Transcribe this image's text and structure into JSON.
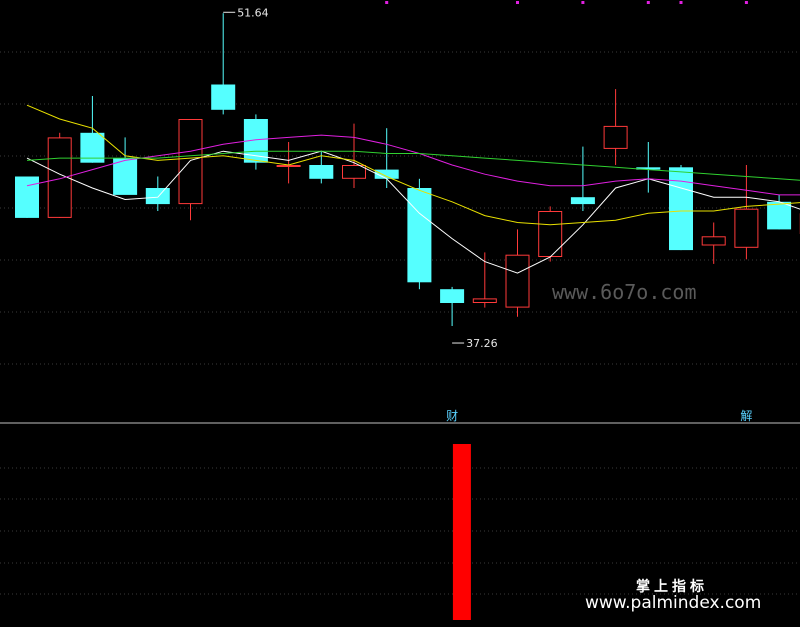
{
  "chart_data": [
    {
      "type": "candlestick",
      "panel": "price",
      "ylim": [
        34,
        52
      ],
      "grid": true,
      "colors": {
        "up": "#ff3a3a",
        "down": "#55ffff",
        "ma_white": "#ffffff",
        "ma_yellow": "#e8e000",
        "ma_magenta": "#e020e0",
        "ma_green": "#30d030"
      },
      "candles": [
        {
          "o": 44.5,
          "h": 44.5,
          "l": 42.7,
          "c": 42.7
        },
        {
          "o": 42.7,
          "h": 46.4,
          "l": 42.7,
          "c": 46.2
        },
        {
          "o": 46.4,
          "h": 48.0,
          "l": 45.1,
          "c": 45.1
        },
        {
          "o": 45.3,
          "h": 46.2,
          "l": 43.8,
          "c": 43.7
        },
        {
          "o": 44.0,
          "h": 44.5,
          "l": 43.0,
          "c": 43.3
        },
        {
          "o": 43.3,
          "h": 47.0,
          "l": 42.6,
          "c": 47.0
        },
        {
          "o": 48.5,
          "h": 51.6,
          "l": 47.2,
          "c": 47.4
        },
        {
          "o": 47.0,
          "h": 47.2,
          "l": 44.8,
          "c": 45.1
        },
        {
          "o": 45.0,
          "h": 46.0,
          "l": 44.2,
          "c": 45.0
        },
        {
          "o": 45.0,
          "h": 45.6,
          "l": 44.2,
          "c": 44.4
        },
        {
          "o": 44.4,
          "h": 46.8,
          "l": 44.0,
          "c": 45.0
        },
        {
          "o": 44.8,
          "h": 46.6,
          "l": 44.0,
          "c": 44.4
        },
        {
          "o": 44.0,
          "h": 44.4,
          "l": 39.6,
          "c": 39.9
        },
        {
          "o": 39.6,
          "h": 39.7,
          "l": 38.0,
          "c": 39.0
        },
        {
          "o": 39.0,
          "h": 41.2,
          "l": 38.8,
          "c": 39.2
        },
        {
          "o": 38.8,
          "h": 42.2,
          "l": 38.4,
          "c": 41.1
        },
        {
          "o": 41.0,
          "h": 43.2,
          "l": 40.8,
          "c": 43.0
        },
        {
          "o": 43.6,
          "h": 45.8,
          "l": 43.0,
          "c": 43.3
        },
        {
          "o": 45.7,
          "h": 48.3,
          "l": 45.0,
          "c": 46.7
        },
        {
          "o": 44.9,
          "h": 46.0,
          "l": 43.8,
          "c": 44.8
        },
        {
          "o": 44.9,
          "h": 45.0,
          "l": 41.3,
          "c": 41.3
        },
        {
          "o": 41.5,
          "h": 42.5,
          "l": 40.7,
          "c": 41.9
        },
        {
          "o": 41.4,
          "h": 45.0,
          "l": 40.9,
          "c": 43.1
        },
        {
          "o": 43.4,
          "h": 43.7,
          "l": 42.2,
          "c": 42.2
        },
        {
          "o": 42.0,
          "h": 43.1,
          "l": 41.1,
          "c": 42.9
        }
      ],
      "ma_lines": [
        {
          "color_key": "ma_white",
          "values": [
            45.3,
            44.6,
            44.0,
            43.5,
            43.6,
            45.2,
            45.6,
            45.4,
            45.2,
            45.6,
            45.1,
            44.4,
            42.9,
            41.8,
            40.8,
            40.3,
            41.0,
            42.4,
            44.0,
            44.4,
            44.0,
            43.6,
            43.6,
            43.4,
            42.9
          ]
        },
        {
          "color_key": "ma_yellow",
          "values": [
            47.6,
            47.0,
            46.6,
            45.4,
            45.2,
            45.3,
            45.4,
            45.2,
            45.0,
            45.4,
            45.2,
            44.5,
            43.9,
            43.4,
            42.8,
            42.5,
            42.4,
            42.5,
            42.6,
            42.9,
            43.0,
            43.0,
            43.2,
            43.3,
            43.4
          ]
        },
        {
          "color_key": "ma_magenta",
          "values": [
            44.1,
            44.4,
            44.8,
            45.2,
            45.4,
            45.6,
            45.9,
            46.1,
            46.2,
            46.3,
            46.2,
            45.9,
            45.5,
            45.0,
            44.6,
            44.3,
            44.1,
            44.1,
            44.3,
            44.4,
            44.3,
            44.1,
            43.9,
            43.7,
            43.7
          ]
        },
        {
          "color_key": "ma_green",
          "values": [
            45.2,
            45.3,
            45.3,
            45.3,
            45.3,
            45.4,
            45.5,
            45.6,
            45.6,
            45.6,
            45.6,
            45.5,
            45.5,
            45.4,
            45.3,
            45.2,
            45.1,
            45.0,
            44.9,
            44.8,
            44.7,
            44.6,
            44.5,
            44.4,
            44.3
          ]
        }
      ],
      "annotations": [
        {
          "text": "51.64",
          "candle": 6,
          "value": 51.64,
          "side": "high"
        },
        {
          "text": "37.26",
          "candle": 13,
          "value": 37.26,
          "side": "low"
        }
      ],
      "event_tags": [
        {
          "text": "财",
          "candle": 13
        },
        {
          "text": "解",
          "candle": 22
        }
      ],
      "top_markers": [
        11,
        15,
        17,
        19,
        20,
        22,
        24,
        25,
        27
      ]
    },
    {
      "type": "bar",
      "panel": "indicator",
      "ylim": [
        0,
        1
      ],
      "color": "#ff0000",
      "bars": [
        {
          "candle": 13.3,
          "value": 1
        }
      ]
    }
  ],
  "watermark": "www.6o7o.com",
  "brand": {
    "cn": "掌上指标",
    "url": "www.palmindex.com"
  }
}
